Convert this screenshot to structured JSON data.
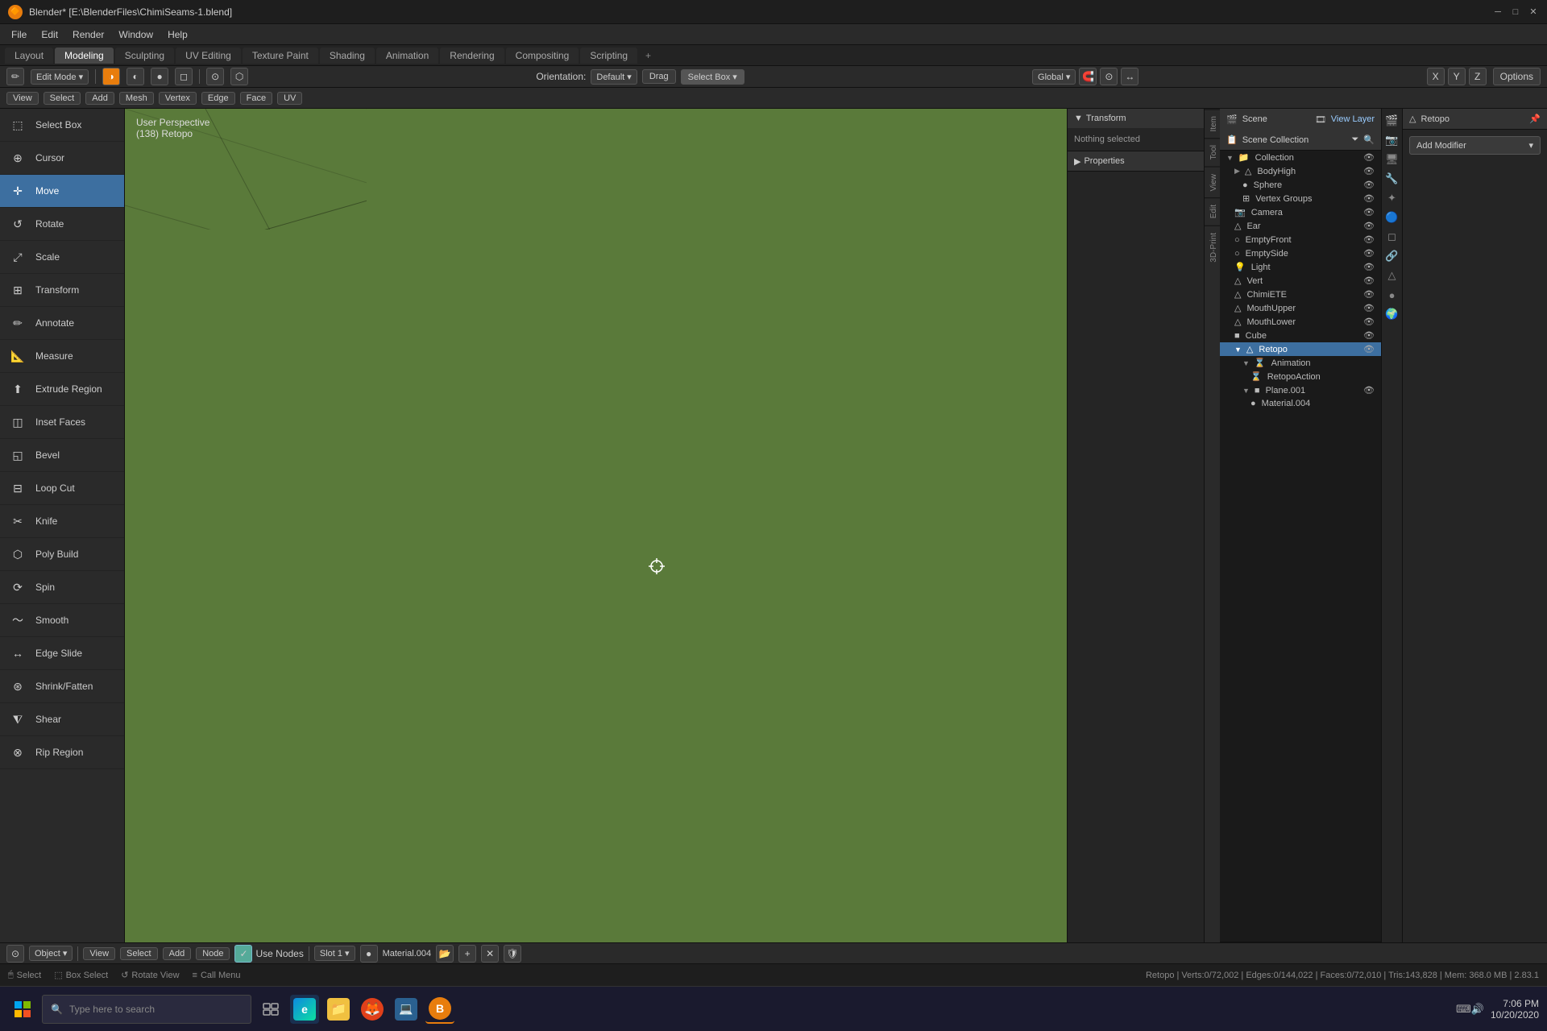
{
  "window": {
    "title": "Blender* [E:\\BlenderFiles\\ChimiSeams-1.blend]",
    "icon": "🔶"
  },
  "titlebar": {
    "min_label": "─",
    "max_label": "□",
    "close_label": "✕"
  },
  "menubar": {
    "items": [
      "File",
      "Edit",
      "Render",
      "Window",
      "Help"
    ],
    "workspace_tabs": [
      "Layout",
      "Modeling",
      "Sculpting",
      "UV Editing",
      "Texture Paint",
      "Shading",
      "Animation",
      "Rendering",
      "Compositing",
      "Scripting"
    ],
    "active_tab": "Layout",
    "add_tab": "+"
  },
  "header": {
    "editor_icon": "✏",
    "mode": "Edit Mode",
    "view_label": "View",
    "select_label": "Select",
    "add_label": "Add",
    "mesh_label": "Mesh",
    "vertex_label": "Vertex",
    "edge_label": "Edge",
    "face_label": "Face",
    "uv_label": "UV",
    "orientation_label": "Orientation:",
    "orientation_value": "Default",
    "drag_label": "Drag",
    "selectbox_label": "Select Box",
    "transform_btn": "↩",
    "global_label": "Global",
    "snap_icon": "🧲",
    "proportional_icon": "⊙",
    "x_label": "X",
    "y_label": "Y",
    "z_label": "Z",
    "options_label": "Options"
  },
  "tools": [
    {
      "id": "select-box",
      "label": "Select Box",
      "icon": "⬚",
      "active": false
    },
    {
      "id": "cursor",
      "label": "Cursor",
      "icon": "⊕",
      "active": false
    },
    {
      "id": "move",
      "label": "Move",
      "icon": "✛",
      "active": true
    },
    {
      "id": "rotate",
      "label": "Rotate",
      "icon": "↺",
      "active": false
    },
    {
      "id": "scale",
      "label": "Scale",
      "icon": "⤢",
      "active": false
    },
    {
      "id": "transform",
      "label": "Transform",
      "icon": "⊞",
      "active": false
    },
    {
      "id": "annotate",
      "label": "Annotate",
      "icon": "✏",
      "active": false
    },
    {
      "id": "measure",
      "label": "Measure",
      "icon": "📐",
      "active": false
    },
    {
      "id": "extrude-region",
      "label": "Extrude Region",
      "icon": "⬆",
      "active": false
    },
    {
      "id": "inset-faces",
      "label": "Inset Faces",
      "icon": "◫",
      "active": false
    },
    {
      "id": "bevel",
      "label": "Bevel",
      "icon": "◱",
      "active": false
    },
    {
      "id": "loop-cut",
      "label": "Loop Cut",
      "icon": "⊟",
      "active": false
    },
    {
      "id": "knife",
      "label": "Knife",
      "icon": "✂",
      "active": false
    },
    {
      "id": "poly-build",
      "label": "Poly Build",
      "icon": "⬡",
      "active": false
    },
    {
      "id": "spin",
      "label": "Spin",
      "icon": "⟳",
      "active": false
    },
    {
      "id": "smooth",
      "label": "Smooth",
      "icon": "〜",
      "active": false
    },
    {
      "id": "edge-slide",
      "label": "Edge Slide",
      "icon": "↔",
      "active": false
    },
    {
      "id": "shrink-fatten",
      "label": "Shrink/Fatten",
      "icon": "⊛",
      "active": false
    },
    {
      "id": "shear",
      "label": "Shear",
      "icon": "⧨",
      "active": false
    },
    {
      "id": "rip-region",
      "label": "Rip Region",
      "icon": "⊗",
      "active": false
    }
  ],
  "viewport": {
    "info_line1": "User Perspective",
    "info_line2": "(138) Retopo",
    "crosshair": "⊕"
  },
  "n_panel": {
    "transform_label": "Transform",
    "nothing_selected": "Nothing selected",
    "properties_label": "Properties"
  },
  "side_tabs": [
    "Item",
    "Tool",
    "View",
    "Edit",
    "3D-Print"
  ],
  "viewport_tools": {
    "zoom": "🔍",
    "hand": "✋",
    "camera": "📷",
    "grid": "⊞"
  },
  "scene_header": {
    "scene_label": "Scene",
    "scene_icon": "🎬",
    "view_layer_label": "View Layer",
    "scene_name": "Scene",
    "view_layer_name": "View Layer",
    "filter_icon": "🔽",
    "search_placeholder": ""
  },
  "outliner": {
    "items": [
      {
        "indent": 0,
        "label": "Collection",
        "icon": "📁",
        "expanded": true,
        "visible": true,
        "render": true
      },
      {
        "indent": 1,
        "label": "BodyHigh",
        "icon": "▽",
        "expanded": false,
        "visible": true,
        "render": true
      },
      {
        "indent": 2,
        "label": "Sphere",
        "icon": "●",
        "expanded": false,
        "visible": true,
        "render": true
      },
      {
        "indent": 2,
        "label": "Vertex Groups",
        "icon": "⊞",
        "expanded": false,
        "visible": true,
        "render": true
      },
      {
        "indent": 1,
        "label": "Camera",
        "icon": "📷",
        "expanded": false,
        "visible": true,
        "render": true
      },
      {
        "indent": 1,
        "label": "Ear",
        "icon": "▽",
        "expanded": false,
        "visible": true,
        "render": true
      },
      {
        "indent": 1,
        "label": "EmptyFront",
        "icon": "○",
        "expanded": false,
        "visible": true,
        "render": true
      },
      {
        "indent": 1,
        "label": "EmptySide",
        "icon": "○",
        "expanded": false,
        "visible": true,
        "render": true
      },
      {
        "indent": 1,
        "label": "Light",
        "icon": "💡",
        "expanded": false,
        "visible": true,
        "render": true
      },
      {
        "indent": 1,
        "label": "Vert",
        "icon": "▽",
        "expanded": false,
        "visible": true,
        "render": true
      },
      {
        "indent": 1,
        "label": "ChimiETE",
        "icon": "▽",
        "expanded": false,
        "visible": true,
        "render": true
      },
      {
        "indent": 1,
        "label": "MouthUpper",
        "icon": "▽",
        "expanded": false,
        "visible": true,
        "render": true
      },
      {
        "indent": 1,
        "label": "MouthLower",
        "icon": "▽",
        "expanded": false,
        "visible": true,
        "render": true
      },
      {
        "indent": 1,
        "label": "Cube",
        "icon": "■",
        "expanded": false,
        "visible": true,
        "render": true
      },
      {
        "indent": 1,
        "label": "Retopo",
        "icon": "▽",
        "expanded": true,
        "visible": true,
        "render": true,
        "active": true
      },
      {
        "indent": 2,
        "label": "Animation",
        "icon": "⌛",
        "expanded": true,
        "visible": false,
        "render": false
      },
      {
        "indent": 3,
        "label": "RetopoAction",
        "icon": "⌛",
        "expanded": false,
        "visible": false,
        "render": false
      },
      {
        "indent": 2,
        "label": "Plane.001",
        "icon": "■",
        "expanded": true,
        "visible": true,
        "render": true
      },
      {
        "indent": 3,
        "label": "Material.004",
        "icon": "●",
        "expanded": false,
        "visible": false,
        "render": false
      }
    ]
  },
  "properties_panel": {
    "object_label": "Retopo",
    "add_modifier_label": "Add Modifier",
    "modifier_dropdown": "▼"
  },
  "props_icons": [
    "🔗",
    "✏",
    "📷",
    "🔵",
    "🌟",
    "🔴",
    "🟠",
    "🟡",
    "🟢",
    "🔷",
    "🌊"
  ],
  "statusbar": {
    "select_label": "Select",
    "boxselect_label": "Box Select",
    "rotate_view_label": "Rotate View",
    "call_menu_label": "Call Menu",
    "stats": "Retopo | Verts:0/72,002 | Edges:0/144,022 | Faces:0/72,010 | Tris:143,828 | Mem: 368.0 MB | 2.83.1"
  },
  "bottom_toolbar": {
    "object_mode": "Object",
    "view_label": "View",
    "select_label": "Select",
    "add_label": "Add",
    "node_label": "Node",
    "use_nodes_label": "Use Nodes",
    "slot_label": "Slot 1",
    "material_label": "Material.004"
  },
  "taskbar": {
    "search_placeholder": "Type here to search",
    "time": "7:06 PM",
    "date": "10/20/2020",
    "start_icon": "⊞"
  }
}
